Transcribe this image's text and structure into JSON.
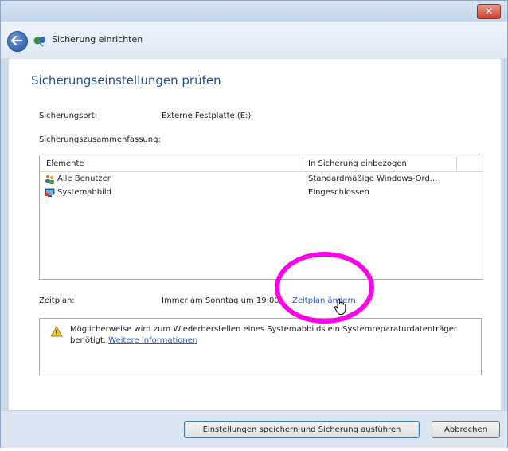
{
  "window": {
    "close_label": "✕",
    "nav_title": "Sicherung einrichten"
  },
  "page": {
    "title": "Sicherungseinstellungen prüfen",
    "location_label": "Sicherungsort:",
    "location_value": "Externe Festplatte (E:)",
    "summary_label": "Sicherungszusammenfassung:"
  },
  "table": {
    "columns": [
      "Elemente",
      "In Sicherung einbezogen"
    ],
    "rows": [
      {
        "icon": "users-icon",
        "name": "Alle Benutzer",
        "value": "Standardmäßige Windows-Ord..."
      },
      {
        "icon": "system-image-icon",
        "name": "Systemabbild",
        "value": "Eingeschlossen"
      }
    ]
  },
  "schedule": {
    "label": "Zeitplan:",
    "value": "Immer am Sonntag um 19:00",
    "change_link": "Zeitplan ändern"
  },
  "info": {
    "text": "Möglicherweise wird zum Wiederherstellen eines Systemabbilds ein Systemreparaturdatenträger benötigt.",
    "link": "Weitere Informationen"
  },
  "footer": {
    "save_run": "Einstellungen speichern und Sicherung ausführen",
    "cancel": "Abbrechen"
  },
  "colors": {
    "annotation_ring": "#ff00e8",
    "title_blue": "#1e4f99",
    "link_blue": "#1f5ed6"
  }
}
